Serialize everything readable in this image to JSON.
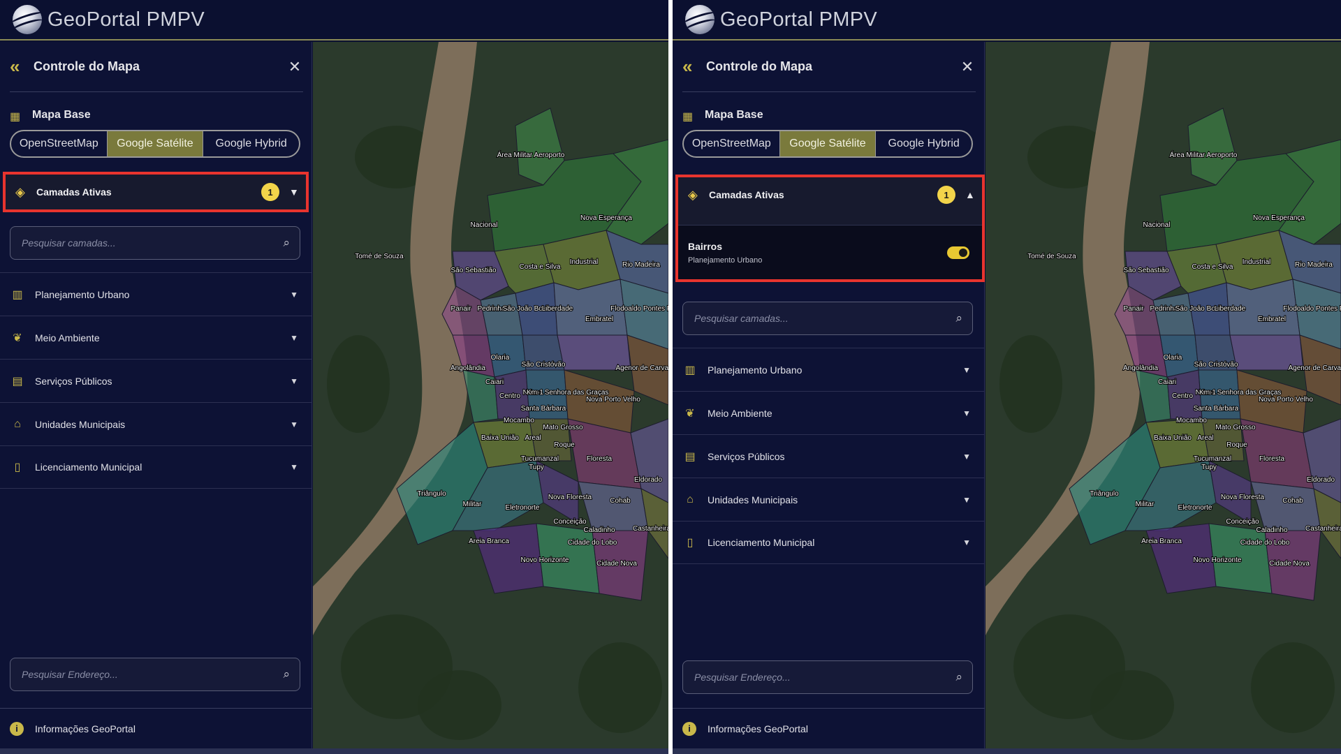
{
  "app": {
    "title": "GeoPortal PMPV"
  },
  "panel": {
    "title": "Controle do Mapa",
    "basemap_label": "Mapa Base",
    "basemap_options": [
      "OpenStreetMap",
      "Google Satélite",
      "Google Hybrid"
    ],
    "basemap_selected": "Google Satélite",
    "active_layers_label": "Camadas Ativas",
    "active_count": "1",
    "active_layer": {
      "name": "Bairros",
      "group": "Planejamento Urbano",
      "enabled": true
    },
    "layer_search_placeholder": "Pesquisar camadas...",
    "categories": [
      {
        "label": "Planejamento Urbano",
        "icon": "city-icon"
      },
      {
        "label": "Meio Ambiente",
        "icon": "sprout-icon"
      },
      {
        "label": "Serviços Públicos",
        "icon": "building-icon"
      },
      {
        "label": "Unidades Municipais",
        "icon": "bank-icon"
      },
      {
        "label": "Licenciamento Municipal",
        "icon": "document-icon"
      }
    ],
    "address_search_placeholder": "Pesquisar Endereço...",
    "info_label": "Informações GeoPortal"
  },
  "map": {
    "place_labels": [
      "Área Militar Aeroporto",
      "Nacional",
      "Nova Esperança",
      "Tomé de Souza",
      "Costa e Silva",
      "Industrial",
      "Rio Madeira",
      "São Sebastião",
      "Panair",
      "Pedrinhas",
      "São João Bosco",
      "Liberdade",
      "Embratel",
      "Flodoaldo Pontes Pinto",
      "Olaria",
      "São Cristóvão",
      "Nossa Senhora das Graças",
      "Agenor de Carvalho",
      "Angolândia",
      "Caiari",
      "Centro",
      "Km-1",
      "Santa Bárbara",
      "Mocambo",
      "Nova Porto Velho",
      "Baixa União",
      "Areal",
      "Mato Grosso",
      "Roque",
      "Tucumanzal",
      "Tupy",
      "Floresta",
      "Eldorado",
      "Triângulo",
      "Militar",
      "Eletronorte",
      "Nova Floresta",
      "Cohab",
      "Conceição",
      "Caladinho",
      "Castanheira",
      "Areia Branca",
      "Cidade do Lobo",
      "Novo Horizonte",
      "Cidade Nova"
    ]
  },
  "colors": {
    "accent": "#c9b84a",
    "badge": "#f2d44a",
    "highlight": "#e8342e",
    "background": "#0b1030"
  }
}
